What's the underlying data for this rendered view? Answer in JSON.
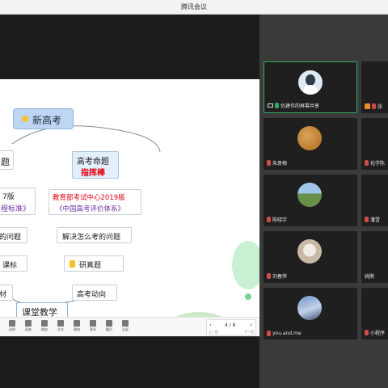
{
  "window": {
    "title": "腾讯会议"
  },
  "slide": {
    "center_title": "新高考",
    "left_fragment_top": "题",
    "right_node_title": "高考命题",
    "right_node_highlight": "指挥棒",
    "left_fragment_mid1": "7版",
    "left_fragment_mid2": "程标准》",
    "right_source_line1": "教育部考试中心2019版",
    "right_source_line2": "《中国高考评价体系》",
    "left_fragment_q": "的问题",
    "right_q": "解决怎么考的问题",
    "left_fragment_std": "课标",
    "right_study": "研真题",
    "left_fragment_bottom": "材",
    "right_trend": "高考动向",
    "classroom": "课堂教学"
  },
  "toolbar": {
    "items": [
      "选择",
      "画笔",
      "橡皮",
      "文本",
      "撤销",
      "更多",
      "翻页",
      "全屏"
    ],
    "page": "4 / 6",
    "prev": "上一页",
    "next": "下一页"
  },
  "participants": [
    {
      "name": "仇建伟的屏幕共享",
      "active": true,
      "mic": "on"
    },
    {
      "name": "张",
      "active": false,
      "mic": "off"
    },
    {
      "name": "朱意梅",
      "active": false,
      "mic": "off"
    },
    {
      "name": "化学陈",
      "active": false,
      "mic": "off"
    },
    {
      "name": "陈晓宇",
      "active": false,
      "mic": "off"
    },
    {
      "name": "潘雪",
      "active": false,
      "mic": "off"
    },
    {
      "name": "刘春萍",
      "active": false,
      "mic": "off"
    },
    {
      "name": "姚鹃",
      "active": false,
      "mic": "off"
    },
    {
      "name": "you.and.me",
      "active": false,
      "mic": "off"
    },
    {
      "name": "小程序",
      "active": false,
      "mic": "off"
    }
  ],
  "colors": {
    "accent_green": "#2fae5f",
    "highlight_red": "#e60012",
    "purple_text": "#6b2fa8"
  }
}
